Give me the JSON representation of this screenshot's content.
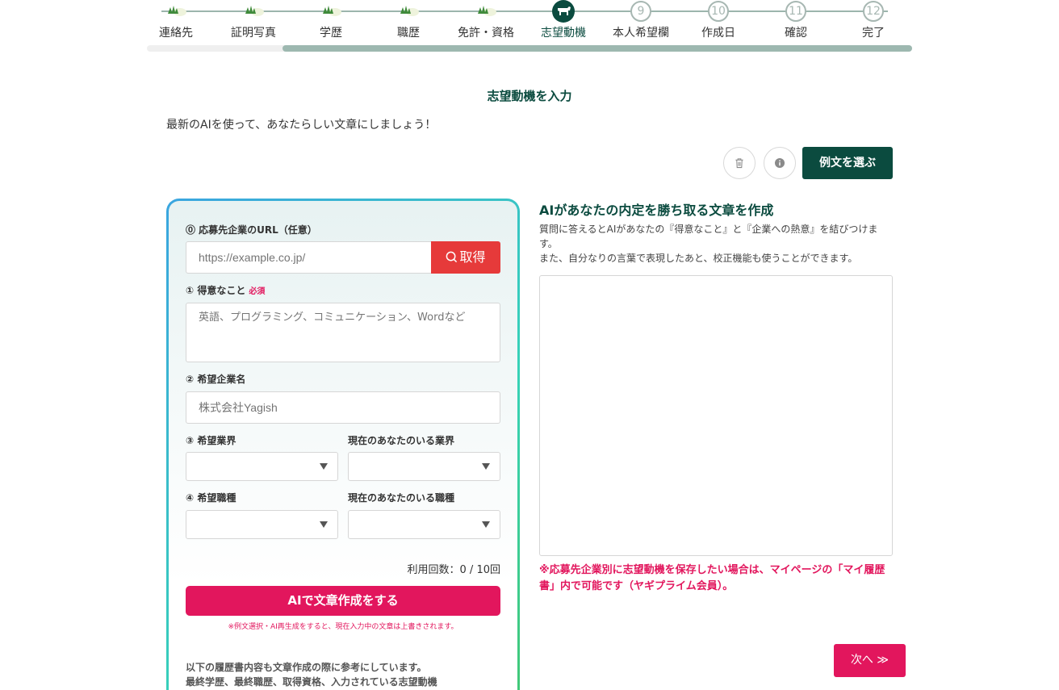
{
  "stepper": {
    "steps": [
      {
        "label": "連絡先",
        "state": "done"
      },
      {
        "label": "証明写真",
        "state": "done"
      },
      {
        "label": "学歴",
        "state": "done"
      },
      {
        "label": "職歴",
        "state": "done"
      },
      {
        "label": "免許・資格",
        "state": "done"
      },
      {
        "label": "志望動機",
        "state": "current"
      },
      {
        "label": "本人希望欄",
        "number": "9",
        "state": "todo"
      },
      {
        "label": "作成日",
        "number": "10",
        "state": "todo"
      },
      {
        "label": "確認",
        "number": "11",
        "state": "todo"
      },
      {
        "label": "完了",
        "number": "12",
        "state": "todo"
      }
    ]
  },
  "page": {
    "title": "志望動機を入力",
    "subtitle": "最新のAIを使って、あなたらしい文章にしましょう！"
  },
  "toolbar": {
    "trash_icon": "trash-icon",
    "info_icon": "info-icon",
    "example_button": "例文を選ぶ"
  },
  "form": {
    "url_label": "⓪ 応募先企業のURL（任意）",
    "url_placeholder": "https://example.co.jp/",
    "fetch_button": "取得",
    "strength_label": "① 得意なこと",
    "required_badge": "必須",
    "strength_placeholder": "英語、プログラミング、コミュニケーション、Wordなど",
    "company_label": "② 希望企業名",
    "company_placeholder": "株式会社Yagish",
    "industry_label": "③ 希望業界",
    "current_industry_label": "現在のあなたのいる業界",
    "job_label": "④ 希望職種",
    "current_job_label": "現在のあなたのいる職種",
    "usage_count": "利用回数：0 / 10回",
    "ai_button": "AIで文章作成をする",
    "overwrite_warning": "※例文選択・AI再生成をすると、現在入力中の文章は上書きされます。",
    "note_line1": "以下の履歴書内容も文章作成の際に参考にしています。",
    "note_line2": "最終学歴、最終職歴、取得資格、入力されている志望動機"
  },
  "result": {
    "title": "AIがあなたの内定を勝ち取る文章を作成",
    "desc_line1": "質問に答えるとAIがあなたの『得意なこと』と『企業への熱意』を結びつけます。",
    "desc_line2": "また、自分なりの言葉で表現したあと、校正機能も使うことができます。",
    "text_value": "",
    "save_warning": "※応募先企業別に志望動機を保存したい場合は、マイページの「マイ履歴書」内で可能です（ヤギプライム会員）。"
  },
  "footer": {
    "next_button": "次へ ≫"
  },
  "colors": {
    "brand_green": "#0b4b3f",
    "accent_pink": "#e2165d",
    "fetch_red": "#e63a3a"
  }
}
